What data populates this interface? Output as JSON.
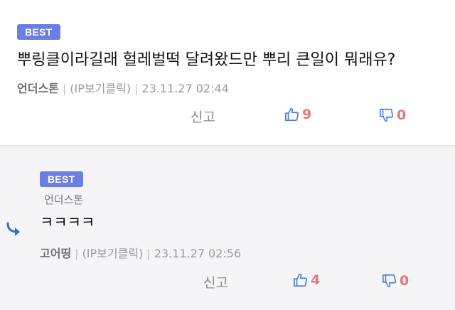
{
  "best_comment": {
    "badge": "BEST",
    "text": "뿌링클이라길래 헐레벌떡 달려왔드만 뿌리 큰일이 뭐래유?",
    "author": "언더스톤",
    "ip_link": "(IP보기클릭)",
    "timestamp": "23.11.27 02:44",
    "report_label": "신고",
    "upvotes": "9",
    "downvotes": "0"
  },
  "reply_comment": {
    "badge": "BEST",
    "parent_author": "언더스톤",
    "text": "ㅋㅋㅋㅋ",
    "author": "고어띵",
    "ip_link": "(IP보기클릭)",
    "timestamp": "23.11.27 02:56",
    "report_label": "신고",
    "upvotes": "4",
    "downvotes": "0"
  },
  "colors": {
    "badge": "#6c7ee1",
    "thumb_icon": "#4a7fd6",
    "count": "#e07a7a",
    "reply_arrow": "#2d6fd6",
    "reply_background": "#f5f5f8"
  },
  "icons": [
    "thumbs-up-icon",
    "thumbs-down-icon",
    "reply-arrow-icon"
  ]
}
